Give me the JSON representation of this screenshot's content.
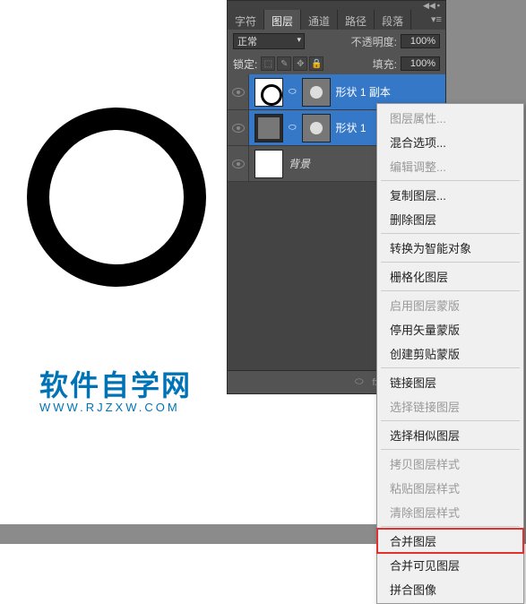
{
  "canvas": {
    "watermark_cn": "软件自学网",
    "watermark_en": "WWW.RJZXW.COM"
  },
  "panel": {
    "tabs": [
      "字符",
      "图层",
      "通道",
      "路径",
      "段落"
    ],
    "active_tab": 1,
    "blend_mode": "正常",
    "opacity_label": "不透明度:",
    "opacity_value": "100%",
    "lock_label": "锁定:",
    "fill_label": "填充:",
    "fill_value": "100%",
    "layers": [
      {
        "name": "形状 1 副本",
        "selected": true,
        "type": "shape"
      },
      {
        "name": "形状 1",
        "selected": true,
        "type": "shape"
      },
      {
        "name": "背景",
        "selected": false,
        "type": "bg"
      }
    ]
  },
  "context_menu": {
    "items": [
      {
        "label": "图层属性...",
        "disabled": true
      },
      {
        "label": "混合选项...",
        "disabled": false
      },
      {
        "label": "编辑调整...",
        "disabled": true
      },
      {
        "sep": true
      },
      {
        "label": "复制图层...",
        "disabled": false
      },
      {
        "label": "删除图层",
        "disabled": false
      },
      {
        "sep": true
      },
      {
        "label": "转换为智能对象",
        "disabled": false
      },
      {
        "sep": true
      },
      {
        "label": "栅格化图层",
        "disabled": false
      },
      {
        "sep": true
      },
      {
        "label": "启用图层蒙版",
        "disabled": true
      },
      {
        "label": "停用矢量蒙版",
        "disabled": false
      },
      {
        "label": "创建剪贴蒙版",
        "disabled": false
      },
      {
        "sep": true
      },
      {
        "label": "链接图层",
        "disabled": false
      },
      {
        "label": "选择链接图层",
        "disabled": true
      },
      {
        "sep": true
      },
      {
        "label": "选择相似图层",
        "disabled": false
      },
      {
        "sep": true
      },
      {
        "label": "拷贝图层样式",
        "disabled": true
      },
      {
        "label": "粘贴图层样式",
        "disabled": true
      },
      {
        "label": "清除图层样式",
        "disabled": true
      },
      {
        "sep": true
      },
      {
        "label": "合并图层",
        "disabled": false,
        "highlight": true
      },
      {
        "label": "合并可见图层",
        "disabled": false
      },
      {
        "label": "拼合图像",
        "disabled": false
      }
    ]
  }
}
